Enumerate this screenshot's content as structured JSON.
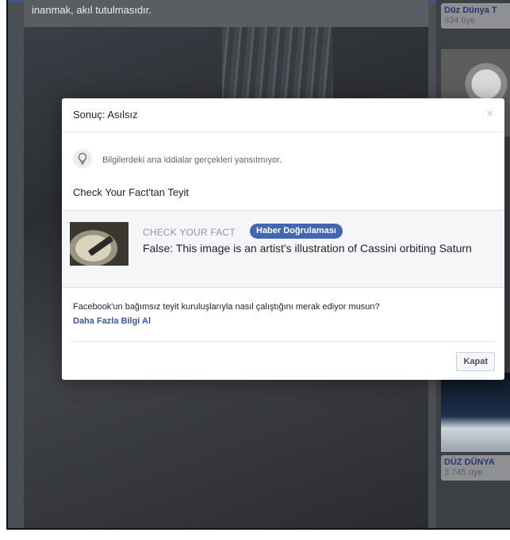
{
  "background": {
    "feed_caption": "inanmak, akıl tutulmasıdır.",
    "right_cards": [
      {
        "title": "Düz Dünya T",
        "sub": "934 üye"
      },
      {
        "title": "DÜZ DÜNYA",
        "sub": "3.745 üye"
      }
    ],
    "right_fragments": [
      "Y",
      "r"
    ]
  },
  "modal": {
    "title": "Sonuç: Asılsız",
    "close_icon": "×",
    "verdict_text": "Bilgilerdeki ana iddialar gerçekleri yansıtmıyor.",
    "section_title": "Check Your Fact'tan Teyit",
    "article": {
      "source": "CHECK YOUR FACT",
      "badge": "Haber Doğrulaması",
      "headline": "False: This image is an artist's illustration of Cassini orbiting Saturn"
    },
    "question": "Facebook'un bağımsız teyit kuruluşlarıyla nasıl çalıştığını merak ediyor musun?",
    "more_link": "Daha Fazla Bilgi Al",
    "close_button": "Kapat"
  },
  "colors": {
    "accent": "#4267b2",
    "link": "#385898",
    "overlay": "#4b4f56"
  },
  "icons": {
    "verdict": "lightbulb-icon",
    "close": "close-icon"
  }
}
